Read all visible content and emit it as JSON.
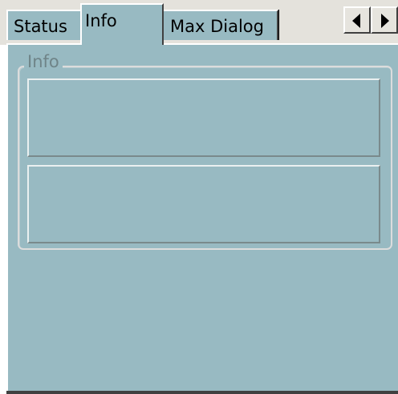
{
  "tabs": {
    "items": [
      {
        "label": "Status",
        "selected": false
      },
      {
        "label": "Info",
        "selected": true
      },
      {
        "label": "Max Dialog",
        "selected": false
      }
    ],
    "scroll_left_icon": "arrow-left-icon",
    "scroll_right_icon": "arrow-right-icon"
  },
  "info_panel": {
    "group_title": "Info",
    "field_1_text": "",
    "field_2_text": ""
  },
  "colors": {
    "panel_background": "#98bac2",
    "tabstrip_background": "#e4e2dc"
  }
}
